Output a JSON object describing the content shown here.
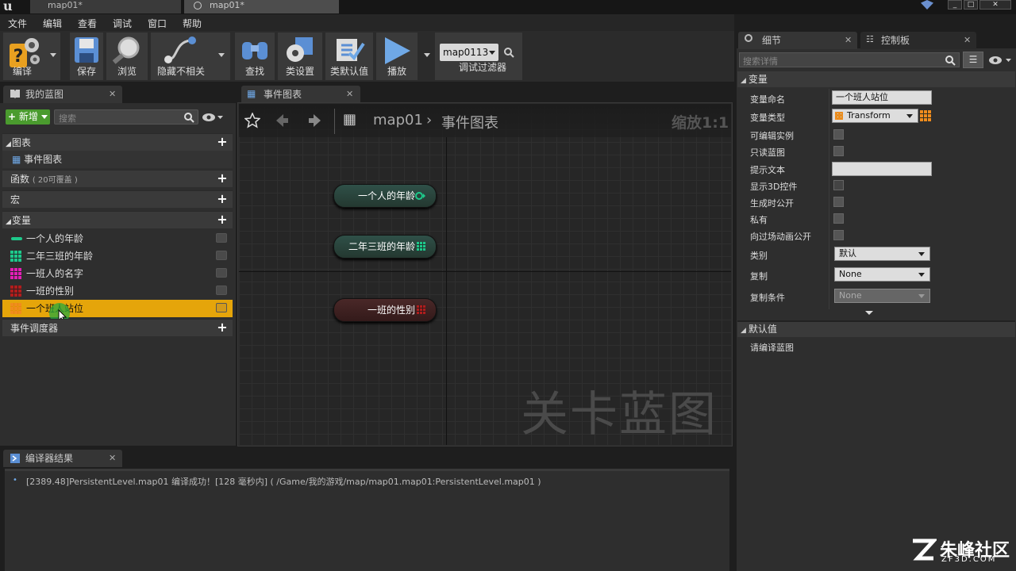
{
  "tabs": [
    "map01*",
    "map01*"
  ],
  "menu": [
    "文件",
    "编辑",
    "查看",
    "调试",
    "窗口",
    "帮助"
  ],
  "toolbar": {
    "compile": "编译",
    "save": "保存",
    "browse": "浏览",
    "hide_unrelated": "隐藏不相关",
    "find": "查找",
    "class_settings": "类设置",
    "class_defaults": "类默认值",
    "play": "播放",
    "debug_object": "map0113",
    "debug_filter": "调试过滤器"
  },
  "my_blueprint": {
    "tab": "我的蓝图",
    "new_button": "新增",
    "search_placeholder": "搜索",
    "sections": {
      "graphs": "图表",
      "event_graph": "事件图表",
      "functions": "函数",
      "functions_note": "( 20可覆盖 )",
      "macros": "宏",
      "variables": "变量",
      "event_dispatchers": "事件调度器"
    },
    "variables": [
      {
        "name": "一个人的年龄",
        "color": "#1ec98b"
      },
      {
        "name": "二年三班的年龄",
        "color": "#1ec98b"
      },
      {
        "name": "一班人的名字",
        "color": "#e31fb5"
      },
      {
        "name": "一班的性别",
        "color": "#b01d1d"
      },
      {
        "name": "一个班人站位",
        "color": "#f08c1e"
      }
    ]
  },
  "graph": {
    "tab": "事件图表",
    "breadcrumb_root": "map01",
    "breadcrumb_leaf": "事件图表",
    "zoom": "缩放1:1",
    "watermark": "关卡蓝图",
    "nodes": [
      "一个人的年龄",
      "二年三班的年龄",
      "一班的性别"
    ]
  },
  "compiler": {
    "tab": "编译器结果",
    "message": "[2389.48]PersistentLevel.map01 编译成功！[128 毫秒内] ( /Game/我的游戏/map/map01.map01:PersistentLevel.map01 )"
  },
  "details": {
    "tab_details": "细节",
    "tab_palette": "控制板",
    "search_placeholder": "搜索详情",
    "section_variable": "变量",
    "var_name_label": "变量命名",
    "var_name_value": "一个班人站位",
    "var_type_label": "变量类型",
    "var_type_value": "Transform",
    "editable_label": "可编辑实例",
    "readonly_label": "只读蓝图",
    "tooltip_label": "提示文本",
    "show3d_label": "显示3D控件",
    "expose_spawn_label": "生成时公开",
    "private_label": "私有",
    "expose_cinematic_label": "向过场动画公开",
    "category_label": "类别",
    "category_value": "默认",
    "replication_label": "复制",
    "replication_value": "None",
    "rep_condition_label": "复制条件",
    "rep_condition_value": "None",
    "section_default": "默认值",
    "default_note": "请编译蓝图"
  },
  "logo": {
    "text": "朱峰社区",
    "sub": "ZF3D.COM"
  }
}
